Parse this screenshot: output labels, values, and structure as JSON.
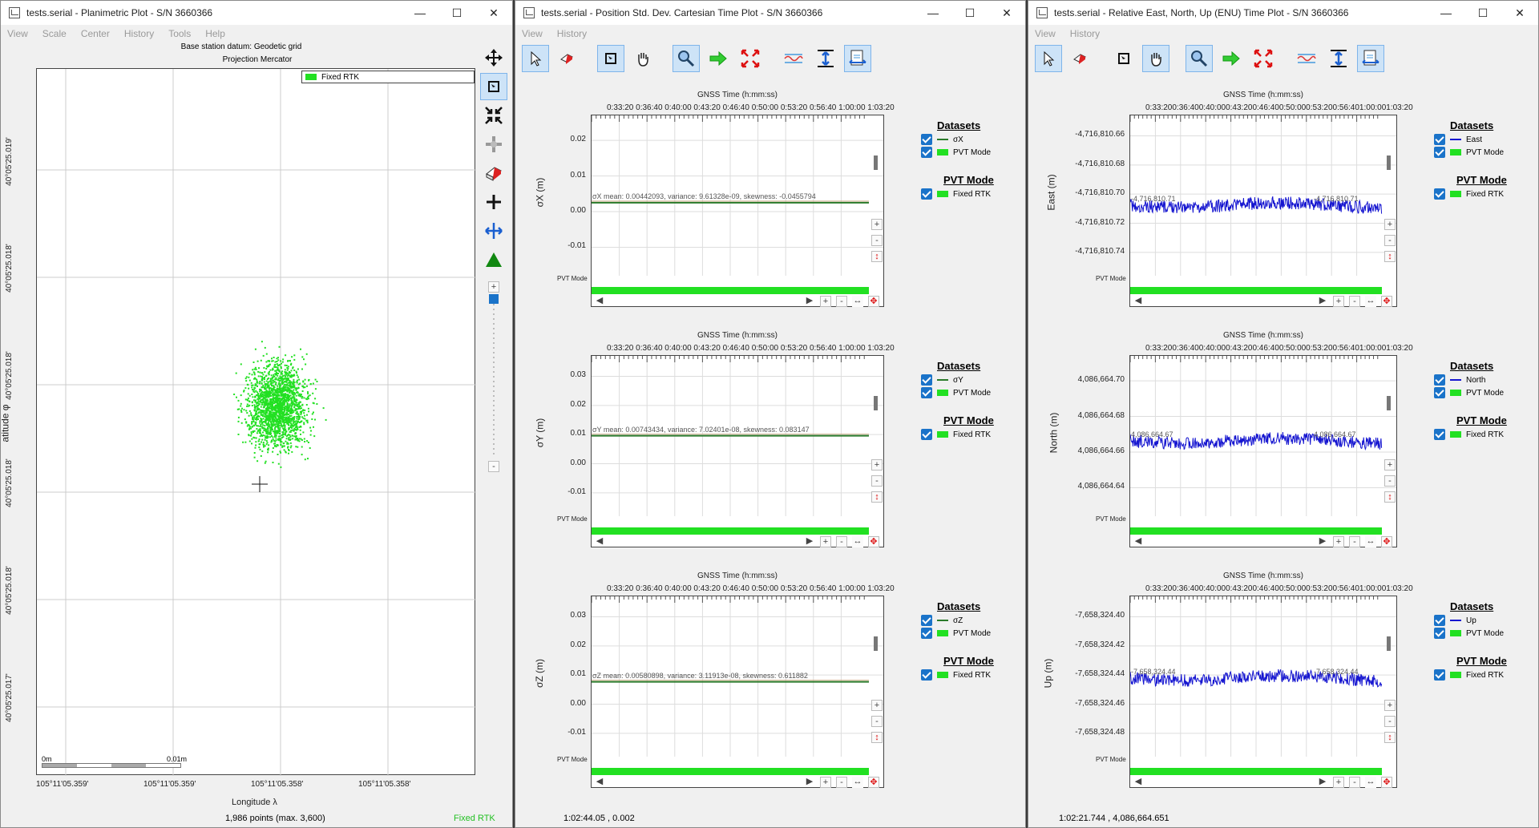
{
  "windows": [
    {
      "title": "tests.serial - Planimetric Plot - S/N 3660366",
      "menu": [
        "View",
        "Scale",
        "Center",
        "History",
        "Tools",
        "Help"
      ]
    },
    {
      "title": "tests.serial - Position Std. Dev. Cartesian Time Plot - S/N 3660366",
      "menu": [
        "View",
        "History"
      ]
    },
    {
      "title": "tests.serial - Relative East, North, Up (ENU) Time Plot - S/N 3660366",
      "menu": [
        "View",
        "History"
      ]
    }
  ],
  "planimetric": {
    "header1": "Base station datum: Geodetic grid",
    "header2": "Projection Mercator",
    "legend": "Fixed RTK",
    "ylabel": "atitude φ",
    "yticks": [
      "40°05'25.019'",
      "40°05'25.018'",
      "40°05'25.018'",
      "40°05'25.018'",
      "40°05'25.018'",
      "40°05'25.017'"
    ],
    "xticks": [
      "105°11'05.359'",
      "105°11'05.359'",
      "105°11'05.358'",
      "105°11'05.358'"
    ],
    "xlabel": "Longitude λ",
    "scale_0": "0m",
    "scale_1": "0.01m",
    "status_points": "1,986 points (max. 3,600)",
    "status_mode": "Fixed RTK",
    "accent": "#22e022"
  },
  "timeplots": {
    "xaxis_title": "GNSS Time (h:mm:ss)",
    "xticks_std": "0:33:20 0:36:40 0:40:00 0:43:20 0:46:40 0:50:00 0:53:20 0:56:40 1:00:00 1:03:20",
    "xticks_enu": "0:33:200:36:400:40:000:43:200:46:400:50:000:53:200:56:401:00:001:03:20",
    "pvt_label": "PVT Mode",
    "legend_datasets": "Datasets",
    "legend_pvt": "PVT Mode",
    "legend_fixed": "Fixed RTK"
  },
  "std_plots": [
    {
      "ylabel": "σX (m)",
      "yticks": [
        "0.02",
        "0.01",
        "0.00",
        "-0.01"
      ],
      "series": "σX",
      "stats": "σX mean: 0.00442093, variance: 9.61328e-09, skewness: -0.0455794",
      "level": 0.0044,
      "ymin": -0.017,
      "ymax": 0.03
    },
    {
      "ylabel": "σY (m)",
      "yticks": [
        "0.03",
        "0.02",
        "0.01",
        "0.00",
        "-0.01"
      ],
      "series": "σY",
      "stats": "σY mean: 0.00743434, variance: 7.02401e-08, skewness: 0.083147",
      "level": 0.0086,
      "ymin": -0.017,
      "ymax": 0.034
    },
    {
      "ylabel": "σZ (m)",
      "yticks": [
        "0.03",
        "0.02",
        "0.01",
        "0.00",
        "-0.01"
      ],
      "series": "σZ",
      "stats": "σZ mean: 0.00580898, variance: 3.11913e-08, skewness: 0.611882",
      "level": 0.0068,
      "ymin": -0.017,
      "ymax": 0.034
    }
  ],
  "enu_plots": [
    {
      "ylabel": "East (m)",
      "yticks": [
        "-4,716,810.66",
        "-4,716,810.68",
        "-4,716,810.70",
        "-4,716,810.72",
        "-4,716,810.74"
      ],
      "series": "East",
      "stats": "-4,716,810.71",
      "stats2": "-4,716,810.71",
      "level": 0.56
    },
    {
      "ylabel": "North (m)",
      "yticks": [
        "4,086,664.70",
        "4,086,664.68",
        "4,086,664.66",
        "4,086,664.64"
      ],
      "series": "North",
      "stats": "4,086,664.67",
      "stats2": "4,086,664.67",
      "level": 0.53
    },
    {
      "ylabel": "Up (m)",
      "yticks": [
        "-7,658,324.40",
        "-7,658,324.42",
        "-7,658,324.44",
        "-7,658,324.46",
        "-7,658,324.48"
      ],
      "series": "Up",
      "stats": "-7,658,324.44",
      "stats2": "-7,658,324.44",
      "level": 0.51
    }
  ],
  "status_std": "1:02:44.05 , 0.002",
  "status_enu": "1:02:21.744 , 4,086,664.651"
}
